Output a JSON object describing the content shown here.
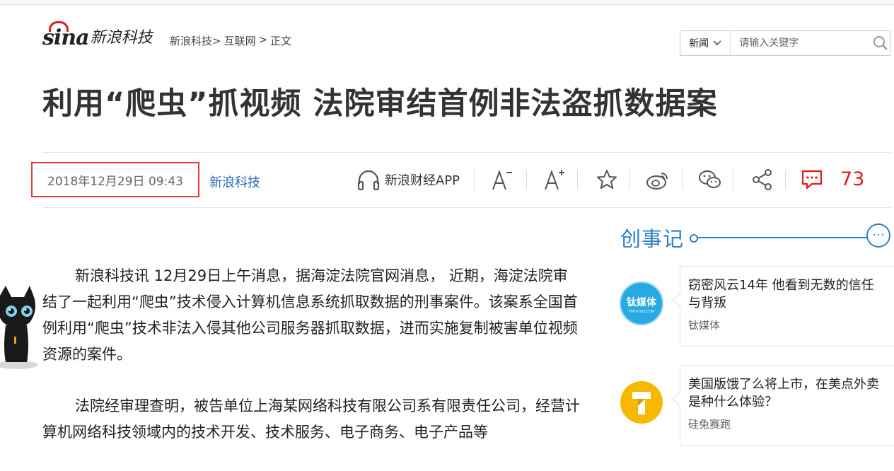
{
  "header": {
    "logo_brand": "sina",
    "logo_name": "新浪科技",
    "breadcrumb": [
      "新浪科技>",
      "互联网",
      ">",
      "正文"
    ]
  },
  "search": {
    "category": "新闻",
    "placeholder": "请输入关键字"
  },
  "article": {
    "title": "利用“爬虫”抓视频 法院审结首例非法盗抓数据案",
    "date": "2018年12月29日 09:43",
    "source": "新浪科技",
    "paragraphs": [
      "新浪科技讯 12月29日上午消息，据海淀法院官网消息， 近期，海淀法院审结了一起利用“爬虫”技术侵入计算机信息系统抓取数据的刑事案件。该案系全国首例利用“爬虫”技术非法入侵其他公司服务器抓取数据，进而实施复制被害单位视频资源的案件。",
      "法院经审理查明，被告单位上海某网络科技有限公司系有限责任公司，经营计算机网络科技领域内的技术开发、技术服务、电子商务、电子产品等"
    ]
  },
  "toolbar": {
    "app_label": "新浪财经APP",
    "comment_count": "73",
    "icons": [
      "headphones-icon",
      "font-decrease-icon",
      "font-increase-icon",
      "star-icon",
      "weibo-icon",
      "wechat-icon",
      "share-icon",
      "comment-icon"
    ]
  },
  "sidebar": {
    "title": "创事记",
    "more": "···",
    "cards": [
      {
        "title": "窃密风云14年 他看到无数的信任与背叛",
        "author": "钛媒体",
        "logo_text": "钛媒体",
        "logo_sub": "TMTPOST.COM",
        "logo_color": "#27a7e0"
      },
      {
        "title": "美国版饿了么将上市，在美点外卖是种什么体验？",
        "author": "硅兔赛跑",
        "logo_color": "#f6b800"
      }
    ]
  },
  "colors": {
    "accent_red": "#e4191a",
    "link_blue": "#2a69b4",
    "sidebar_blue": "#2a80c9",
    "date_border": "#e23c3c"
  }
}
